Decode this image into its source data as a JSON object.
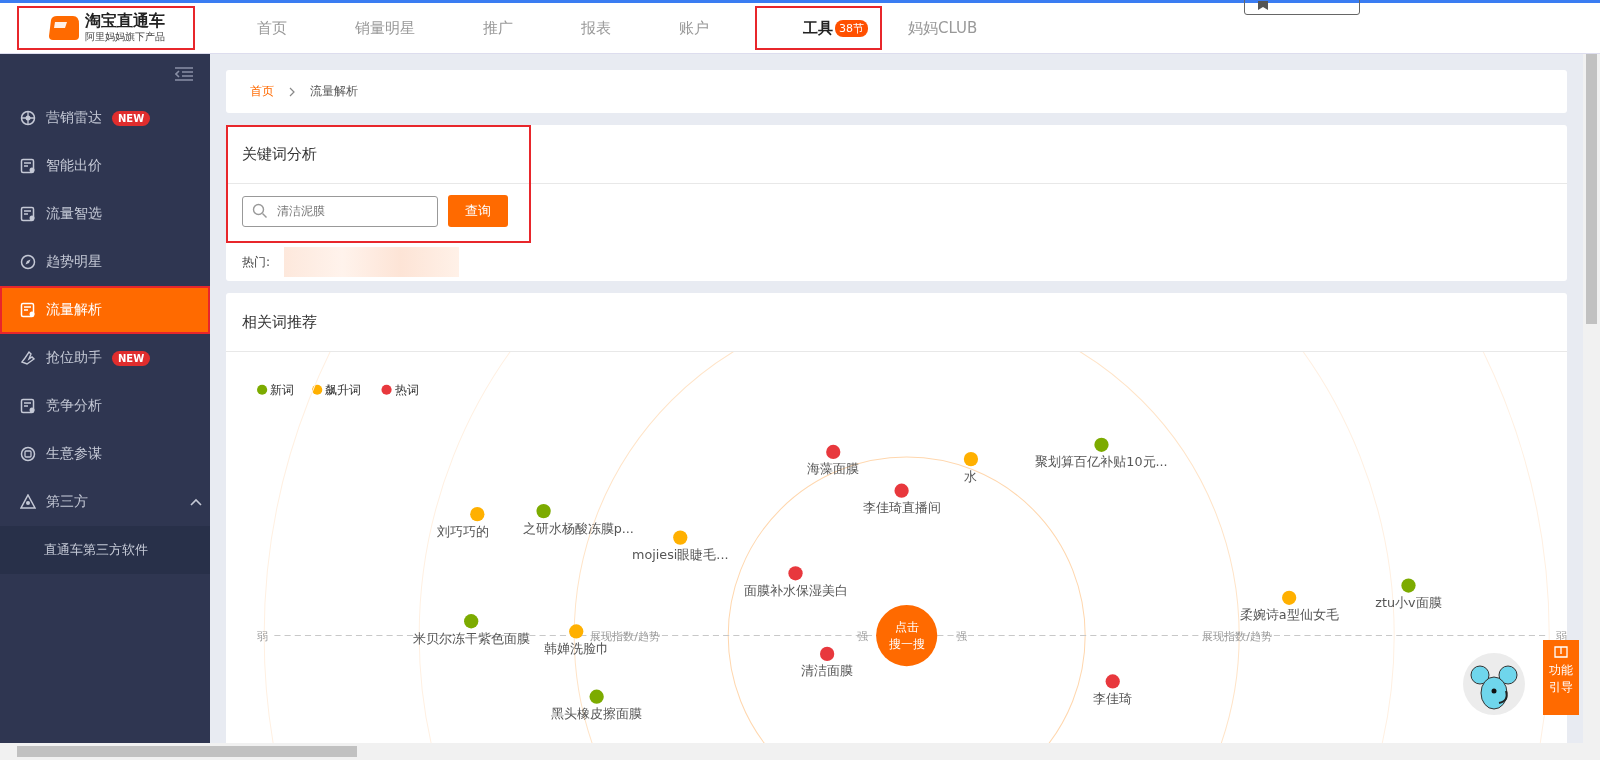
{
  "header": {
    "logo": {
      "title": "淘宝直通车",
      "subtitle": "阿里妈妈旗下产品",
      "outlined": true
    },
    "nav": [
      {
        "label": "首页",
        "selected": false,
        "outlined": false
      },
      {
        "label": "销量明星",
        "selected": false,
        "outlined": false
      },
      {
        "label": "推广",
        "selected": false,
        "outlined": false
      },
      {
        "label": "报表",
        "selected": false,
        "outlined": false
      },
      {
        "label": "账户",
        "selected": false,
        "outlined": false
      },
      {
        "label": "工具",
        "selected": true,
        "badge": "38节",
        "outlined": true
      },
      {
        "label": "妈妈CLUB",
        "selected": false,
        "outlined": false
      }
    ]
  },
  "sidebar": {
    "items": [
      {
        "label": "营销雷达",
        "badge": "NEW",
        "selected": false,
        "outlined": false
      },
      {
        "label": "智能出价",
        "selected": false,
        "outlined": false
      },
      {
        "label": "流量智选",
        "selected": false,
        "outlined": false
      },
      {
        "label": "趋势明星",
        "selected": false,
        "outlined": false
      },
      {
        "label": "流量解析",
        "selected": true,
        "outlined": true
      },
      {
        "label": "抢位助手",
        "badge": "NEW",
        "selected": false,
        "outlined": false
      },
      {
        "label": "竞争分析",
        "selected": false,
        "outlined": false
      },
      {
        "label": "生意参谋",
        "selected": false,
        "outlined": false
      },
      {
        "label": "第三方",
        "selected": false,
        "outlined": false,
        "expanded": true,
        "children": [
          {
            "label": "直通车第三方软件",
            "selected": false
          }
        ]
      }
    ]
  },
  "breadcrumb": [
    {
      "label": "首页",
      "kind": "link"
    },
    {
      "label": "流量解析",
      "kind": "current"
    }
  ],
  "keyword_analysis": {
    "title": "关键词分析",
    "outlined": true,
    "search": {
      "placeholder": "清洁泥膜"
    },
    "button": "查询",
    "hot_label": "热门:"
  },
  "related_words": {
    "title": "相关词推荐",
    "legend": [
      {
        "label": "新词",
        "color": "#7cab00"
      },
      {
        "label": "飙升词",
        "color": "#ffb000"
      },
      {
        "label": "热词",
        "color": "#e8383d"
      }
    ],
    "axis_labels": [
      "弱",
      "展现指数/趋势",
      "强",
      "强",
      "展现指数/趋势",
      "弱"
    ],
    "center_button": [
      "点击",
      "搜一搜"
    ],
    "words": [
      {
        "label": "海藻面膜",
        "color": "#e8383d"
      },
      {
        "label": "水",
        "color": "#ffb000"
      },
      {
        "label": "聚划算百亿补贴10元...",
        "color": "#7cab00"
      },
      {
        "label": "李佳琦直播间",
        "color": "#e8383d"
      },
      {
        "label": "刘巧巧的",
        "color": "#ffb000"
      },
      {
        "label": "之研水杨酸冻膜p...",
        "color": "#7cab00"
      },
      {
        "label": "mojiesi眼睫毛...",
        "color": "#ffb000"
      },
      {
        "label": "面膜补水保湿美白",
        "color": "#e8383d"
      },
      {
        "label": "柔婉诗a型仙女毛",
        "color": "#ffb000"
      },
      {
        "label": "ztu小v面膜",
        "color": "#7cab00"
      },
      {
        "label": "米贝尔冻干紫色面膜",
        "color": "#7cab00"
      },
      {
        "label": "韩婵洗脸巾",
        "color": "#ffb000"
      },
      {
        "label": "清洁面膜",
        "color": "#e8383d"
      },
      {
        "label": "李佳琦",
        "color": "#e8383d"
      },
      {
        "label": "黑头橡皮擦面膜",
        "color": "#7cab00"
      }
    ]
  },
  "guide_button": "功能引导"
}
